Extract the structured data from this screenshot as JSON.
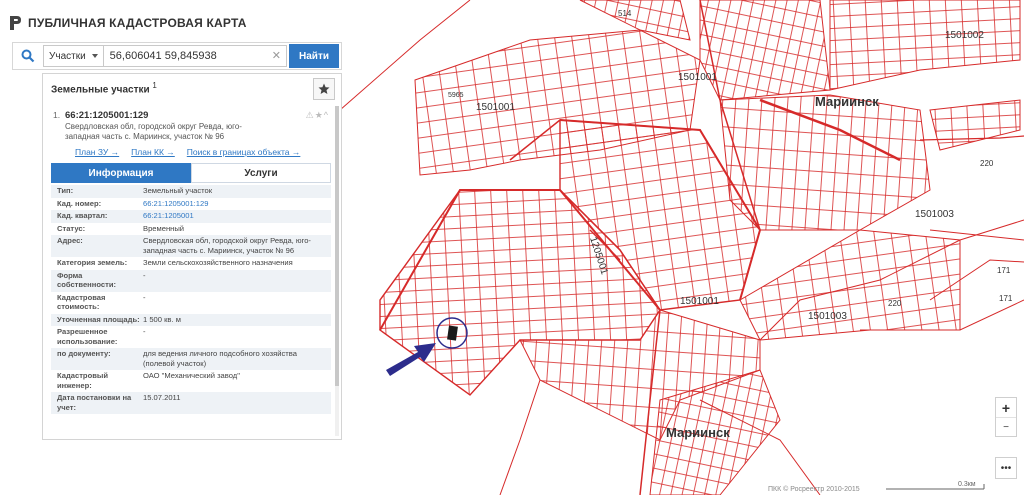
{
  "app": {
    "title": "ПУБЛИЧНАЯ КАДАСТРОВАЯ КАРТА"
  },
  "search": {
    "type": "Участки",
    "query": "56,606041 59,845938",
    "button": "Найти"
  },
  "panel": {
    "title": "Земельные участки",
    "count": "1",
    "item": {
      "index": "1.",
      "cad_number": "66:21:1205001:129",
      "address": "Свердловская обл, городской округ Ревда, юго-западная часть с. Мариинск, участок № 96",
      "links": [
        "План ЗУ →",
        "План КК →",
        "Поиск в границах объекта →"
      ],
      "tabs": [
        "Информация",
        "Услуги"
      ],
      "fields": [
        {
          "label": "Тип:",
          "value": "Земельный участок"
        },
        {
          "label": "Кад. номер:",
          "value": "66:21:1205001:129",
          "link": true
        },
        {
          "label": "Кад. квартал:",
          "value": "66:21:1205001",
          "link": true
        },
        {
          "label": "Статус:",
          "value": "Временный"
        },
        {
          "label": "Адрес:",
          "value": "Свердловская обл, городской округ Ревда, юго-западная часть с. Мариинск, участок № 96"
        },
        {
          "label": "Категория земель:",
          "value": "Земли сельскохозяйственного назначения"
        },
        {
          "label": "Форма собственности:",
          "value": "-"
        },
        {
          "label": "Кадастровая стоимость:",
          "value": "-"
        },
        {
          "label": "Уточненная площадь:",
          "value": "1 500 кв. м"
        },
        {
          "label": "Разрешенное использование:",
          "value": "-"
        },
        {
          "label": "по документу:",
          "value": "для ведения личного подсобного хозяйства (полевой участок)"
        },
        {
          "label": "Кадастровый инженер:",
          "value": "ОАО \"Механический завод\""
        },
        {
          "label": "Дата постановки на учет:",
          "value": "15.07.2011"
        }
      ]
    }
  },
  "map": {
    "labels": {
      "town_top": "Мариинск",
      "town_bottom": "Мариинск",
      "q_1501001_a": "1501001",
      "q_1501001_b": "1501001",
      "q_1501001_c": "1501001",
      "q_1501002": "1501002",
      "q_1501003_a": "1501003",
      "q_1501003_b": "1501003",
      "q_1205001": "1205001",
      "n514": "514",
      "n220_a": "220",
      "n220_b": "220",
      "n171_a": "171",
      "n171_b": "171",
      "n5965": "5965"
    },
    "colors": {
      "parcel_line": "#d62a2a",
      "arrow": "#2c2c8c",
      "marker": "#1a1a1a"
    }
  },
  "controls": {
    "zoom_in": "+",
    "zoom_out": "−",
    "more": "•••"
  },
  "footer": {
    "copyright": "ПКК © Росреестр 2010-2015",
    "scale": "0.3км"
  }
}
